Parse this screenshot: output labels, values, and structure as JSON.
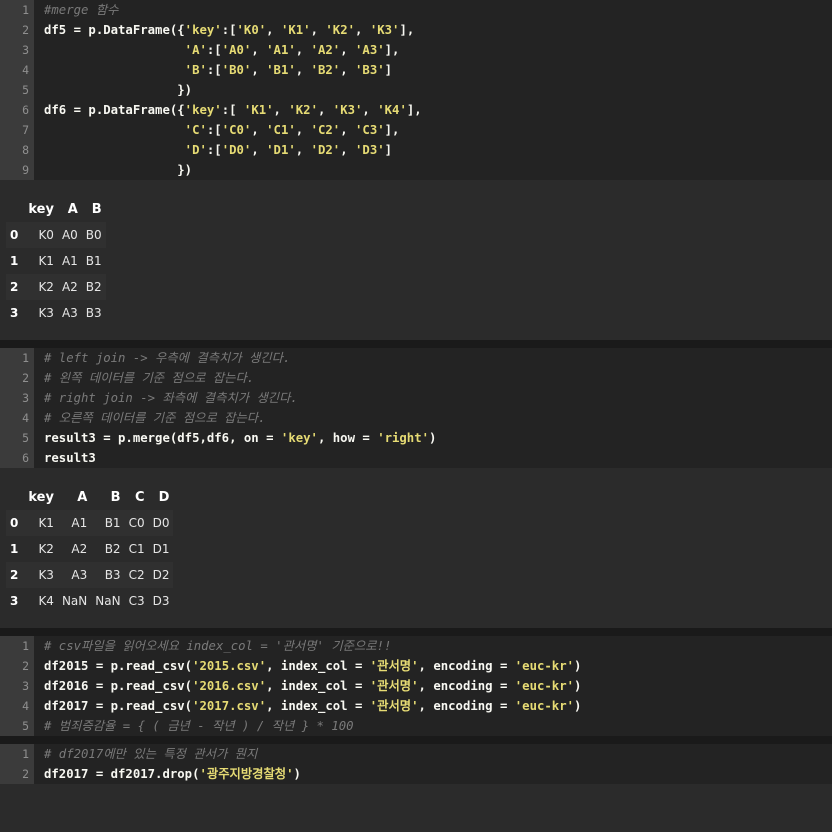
{
  "cells": [
    {
      "lines": [
        [
          {
            "t": "#merge 함수",
            "c": "cm"
          }
        ],
        [
          {
            "t": "df5 = p.DataFrame({"
          },
          {
            "t": "'key'",
            "c": "str"
          },
          {
            "t": ":["
          },
          {
            "t": "'K0'",
            "c": "str"
          },
          {
            "t": ", "
          },
          {
            "t": "'K1'",
            "c": "str"
          },
          {
            "t": ", "
          },
          {
            "t": "'K2'",
            "c": "str"
          },
          {
            "t": ", "
          },
          {
            "t": "'K3'",
            "c": "str"
          },
          {
            "t": "],"
          }
        ],
        [
          {
            "t": "                   "
          },
          {
            "t": "'A'",
            "c": "str"
          },
          {
            "t": ":["
          },
          {
            "t": "'A0'",
            "c": "str"
          },
          {
            "t": ", "
          },
          {
            "t": "'A1'",
            "c": "str"
          },
          {
            "t": ", "
          },
          {
            "t": "'A2'",
            "c": "str"
          },
          {
            "t": ", "
          },
          {
            "t": "'A3'",
            "c": "str"
          },
          {
            "t": "],"
          }
        ],
        [
          {
            "t": "                   "
          },
          {
            "t": "'B'",
            "c": "str"
          },
          {
            "t": ":["
          },
          {
            "t": "'B0'",
            "c": "str"
          },
          {
            "t": ", "
          },
          {
            "t": "'B1'",
            "c": "str"
          },
          {
            "t": ", "
          },
          {
            "t": "'B2'",
            "c": "str"
          },
          {
            "t": ", "
          },
          {
            "t": "'B3'",
            "c": "str"
          },
          {
            "t": "]"
          }
        ],
        [
          {
            "t": "                  })"
          }
        ],
        [
          {
            "t": "df6 = p.DataFrame({"
          },
          {
            "t": "'key'",
            "c": "str"
          },
          {
            "t": ":[ "
          },
          {
            "t": "'K1'",
            "c": "str"
          },
          {
            "t": ", "
          },
          {
            "t": "'K2'",
            "c": "str"
          },
          {
            "t": ", "
          },
          {
            "t": "'K3'",
            "c": "str"
          },
          {
            "t": ", "
          },
          {
            "t": "'K4'",
            "c": "str"
          },
          {
            "t": "],"
          }
        ],
        [
          {
            "t": "                   "
          },
          {
            "t": "'C'",
            "c": "str"
          },
          {
            "t": ":["
          },
          {
            "t": "'C0'",
            "c": "str"
          },
          {
            "t": ", "
          },
          {
            "t": "'C1'",
            "c": "str"
          },
          {
            "t": ", "
          },
          {
            "t": "'C2'",
            "c": "str"
          },
          {
            "t": ", "
          },
          {
            "t": "'C3'",
            "c": "str"
          },
          {
            "t": "],"
          }
        ],
        [
          {
            "t": "                   "
          },
          {
            "t": "'D'",
            "c": "str"
          },
          {
            "t": ":["
          },
          {
            "t": "'D0'",
            "c": "str"
          },
          {
            "t": ", "
          },
          {
            "t": "'D1'",
            "c": "str"
          },
          {
            "t": ", "
          },
          {
            "t": "'D2'",
            "c": "str"
          },
          {
            "t": ", "
          },
          {
            "t": "'D3'",
            "c": "str"
          },
          {
            "t": "]"
          }
        ],
        [
          {
            "t": "                  })"
          }
        ]
      ],
      "output": {
        "columns": [
          "",
          "key",
          "A",
          "B"
        ],
        "rows": [
          [
            "0",
            "K0",
            "A0",
            "B0"
          ],
          [
            "1",
            "K1",
            "A1",
            "B1"
          ],
          [
            "2",
            "K2",
            "A2",
            "B2"
          ],
          [
            "3",
            "K3",
            "A3",
            "B3"
          ]
        ]
      }
    },
    {
      "lines": [
        [
          {
            "t": "# left join -> 우측에 결측치가 생긴다.",
            "c": "cm"
          }
        ],
        [
          {
            "t": "# 왼쪽 데이터를 기준 점으로 잡는다.",
            "c": "cm"
          }
        ],
        [
          {
            "t": "# right join -> 좌측에 결측치가 생긴다.",
            "c": "cm"
          }
        ],
        [
          {
            "t": "# 오른쪽 데이터를 기준 점으로 잡는다.",
            "c": "cm"
          }
        ],
        [
          {
            "t": "result3 = p.merge(df5,df6, on = "
          },
          {
            "t": "'key'",
            "c": "str"
          },
          {
            "t": ", how = "
          },
          {
            "t": "'right'",
            "c": "str"
          },
          {
            "t": ")"
          }
        ],
        [
          {
            "t": "result3"
          }
        ]
      ],
      "output": {
        "columns": [
          "",
          "key",
          "A",
          "B",
          "C",
          "D"
        ],
        "rows": [
          [
            "0",
            "K1",
            "A1",
            "B1",
            "C0",
            "D0"
          ],
          [
            "1",
            "K2",
            "A2",
            "B2",
            "C1",
            "D1"
          ],
          [
            "2",
            "K3",
            "A3",
            "B3",
            "C2",
            "D2"
          ],
          [
            "3",
            "K4",
            "NaN",
            "NaN",
            "C3",
            "D3"
          ]
        ]
      }
    },
    {
      "lines": [
        [
          {
            "t": "# csv파일을 읽어오세요 index_col = '관서명' 기준으로!!",
            "c": "cm"
          }
        ],
        [
          {
            "t": "df2015 = p.read_csv("
          },
          {
            "t": "'2015.csv'",
            "c": "str"
          },
          {
            "t": ", index_col = "
          },
          {
            "t": "'관서명'",
            "c": "str"
          },
          {
            "t": ", encoding = "
          },
          {
            "t": "'euc-kr'",
            "c": "str"
          },
          {
            "t": ")"
          }
        ],
        [
          {
            "t": "df2016 = p.read_csv("
          },
          {
            "t": "'2016.csv'",
            "c": "str"
          },
          {
            "t": ", index_col = "
          },
          {
            "t": "'관서명'",
            "c": "str"
          },
          {
            "t": ", encoding = "
          },
          {
            "t": "'euc-kr'",
            "c": "str"
          },
          {
            "t": ")"
          }
        ],
        [
          {
            "t": "df2017 = p.read_csv("
          },
          {
            "t": "'2017.csv'",
            "c": "str"
          },
          {
            "t": ", index_col = "
          },
          {
            "t": "'관서명'",
            "c": "str"
          },
          {
            "t": ", encoding = "
          },
          {
            "t": "'euc-kr'",
            "c": "str"
          },
          {
            "t": ")"
          }
        ],
        [
          {
            "t": "# 범죄증감율 = { ( 금년 - 작년 ) / 작년 } * 100",
            "c": "cm"
          }
        ]
      ],
      "output": null
    },
    {
      "lines": [
        [
          {
            "t": "# df2017에만 있는 특정 관서가 뭔지",
            "c": "cm"
          }
        ],
        [
          {
            "t": "df2017 = df2017.drop("
          },
          {
            "t": "'광주지방경찰청'",
            "c": "str"
          },
          {
            "t": ")"
          }
        ]
      ],
      "output": null
    }
  ]
}
